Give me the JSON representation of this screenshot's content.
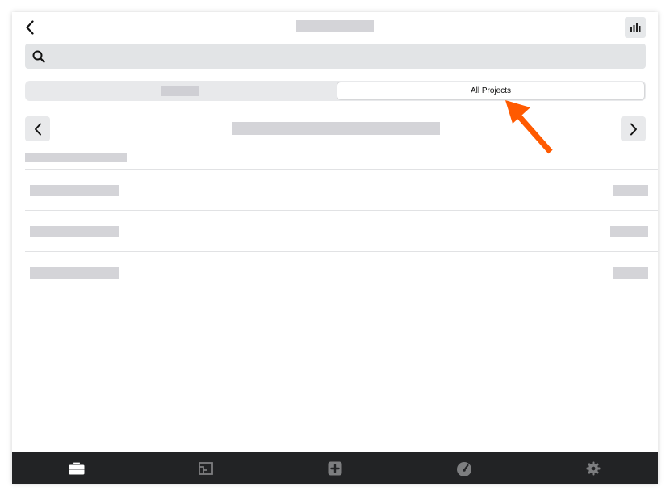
{
  "header": {
    "back_icon": "chevron-left-icon",
    "stats_icon": "bar-chart-icon"
  },
  "search": {
    "icon": "search-icon",
    "placeholder": ""
  },
  "segments": [
    {
      "label": "",
      "selected": false
    },
    {
      "label": "All Projects",
      "selected": true
    }
  ],
  "nav": {
    "prev_icon": "chevron-left-icon",
    "next_icon": "chevron-right-icon"
  },
  "rows": [
    {
      "name": "",
      "value": ""
    },
    {
      "name": "",
      "value": ""
    },
    {
      "name": "",
      "value": ""
    }
  ],
  "bottom_nav": [
    {
      "icon": "briefcase-icon",
      "active": true
    },
    {
      "icon": "floorplan-icon",
      "active": false
    },
    {
      "icon": "plus-square-icon",
      "active": false
    },
    {
      "icon": "speedometer-icon",
      "active": false
    },
    {
      "icon": "gear-icon",
      "active": false
    }
  ],
  "colors": {
    "annotation_arrow": "#ff5a00",
    "bottom_bar": "#222325",
    "active_icon": "#ffffff",
    "inactive_icon": "#7d7e80"
  }
}
